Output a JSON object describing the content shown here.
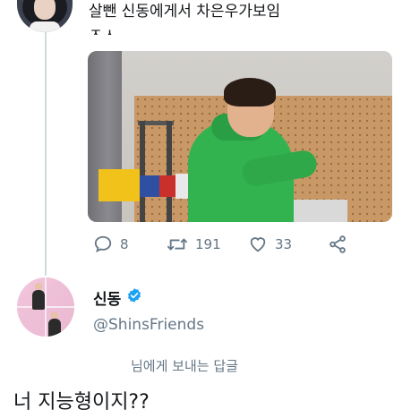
{
  "tweet": {
    "text": "살뺀 신동에게서 차은우가보임",
    "text_line2": "ㅈㅅ",
    "photo_icon": "photo-green-hoodie",
    "actions": {
      "reply_count": "8",
      "retweet_count": "191",
      "like_count": "33"
    }
  },
  "reply": {
    "name": "신동",
    "verified": true,
    "handle": "@ShinsFriends",
    "replying_to": "님에게 보내는 답글",
    "text": "너 지능형이지??"
  },
  "icons": {
    "reply": "speech-bubble-icon",
    "retweet": "retweet-icon",
    "like": "heart-icon",
    "share": "share-icon",
    "verified": "verified-badge-icon"
  },
  "colors": {
    "text": "#14171a",
    "muted": "#657786",
    "verified": "#1da1f2",
    "thread_line": "#cfd9de"
  }
}
